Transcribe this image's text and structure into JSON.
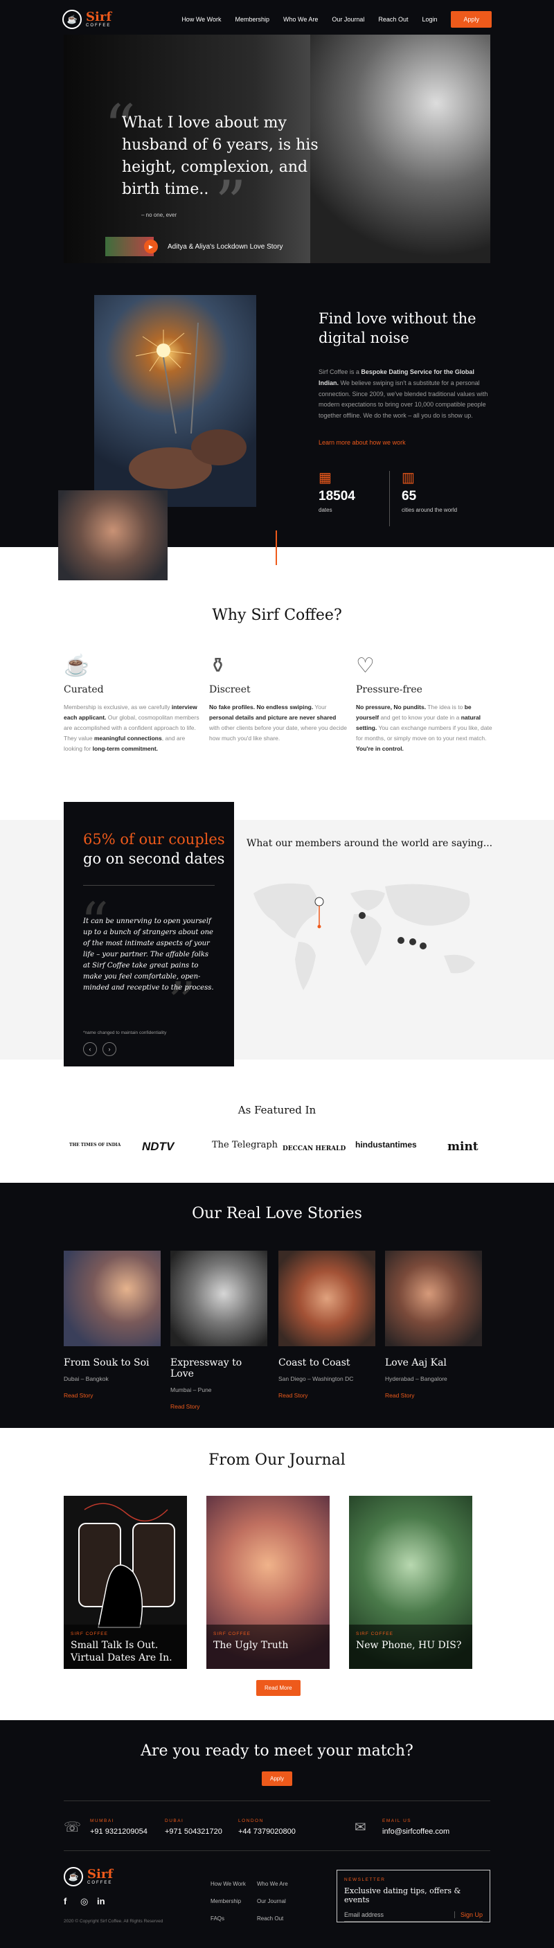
{
  "brand": {
    "logo_text": "Sirf",
    "logo_sub": "COFFEE"
  },
  "nav": {
    "items": [
      "How We Work",
      "Membership",
      "Who We Are",
      "Our Journal",
      "Reach Out",
      "Login"
    ],
    "apply": "Apply"
  },
  "hero": {
    "quote": "What I love about my husband of 6 years, is his height, complexion, and birth time..",
    "byline": "– no one, ever",
    "video_title": "Aditya & Aliya's Lockdown Love Story"
  },
  "intro": {
    "title": "Find love without the digital noise",
    "body_pre": "Sirf Coffee is a ",
    "body_bold": "Bespoke Dating Service for the Global Indian.",
    "body_post": " We believe swiping isn't a substitute for a personal connection. Since 2009, we've blended traditional values with modern expectations to bring over 10,000 compatible people together offline. We do the work – all you do is show up.",
    "link": "Learn more about how we work",
    "stats": [
      {
        "value": "18504",
        "label": "dates"
      },
      {
        "value": "65",
        "label": "cities around the world"
      }
    ]
  },
  "why": {
    "title": "Why Sirf Coffee?",
    "features": [
      {
        "title": "Curated",
        "text_1": "Membership is exclusive, as we carefully ",
        "bold_1": "interview each applicant.",
        "text_2": " Our global, cosmopolitan members are accomplished with a confident approach to life. They value ",
        "bold_2": "meaningful connections",
        "text_3": ", and are looking for ",
        "bold_3": "long-term commitment."
      },
      {
        "title": "Discreet",
        "text_1": "",
        "bold_1": "No fake profiles. No endless swiping.",
        "text_2": " Your ",
        "bold_2": "personal details and picture are never shared",
        "text_3": " with other clients before your date, where you decide how much you'd like share.",
        "bold_3": ""
      },
      {
        "title": "Pressure-free",
        "text_1": "",
        "bold_1": "No pressure, No pundits.",
        "text_2": " The idea is to ",
        "bold_2": "be yourself",
        "text_3": " and get to know your date in a ",
        "bold_3": "natural setting.",
        "text_4": " You can exchange numbers if you like, date for months, or simply move on to your next match. ",
        "bold_4": "You're in control."
      }
    ]
  },
  "testimonial": {
    "stat_highlight": "65% of our couples",
    "stat_rest": "go on second dates",
    "quote": "It can be unnerving to open yourself up to a bunch of strangers about one of the most intimate aspects of your life – your partner. The affable folks at Sirf Coffee take great pains to make you feel comfortable, open-minded and receptive to the process.",
    "note": "*name changed to maintain confidentiality",
    "prev": "‹",
    "next": "›",
    "members_title": "What our members around the world are saying..."
  },
  "featured": {
    "title": "As Featured In",
    "press": [
      "THE TIMES OF INDIA",
      "NDTV",
      "The Telegraph",
      "DECCAN HERALD",
      "hindustantimes",
      "mint"
    ]
  },
  "stories": {
    "title": "Our Real Love Stories",
    "read": "Read Story",
    "items": [
      {
        "title": "From Souk to Soi",
        "location": "Dubai – Bangkok"
      },
      {
        "title": "Expressway to Love",
        "location": "Mumbai – Pune"
      },
      {
        "title": "Coast to Coast",
        "location": "San Diego – Washington DC"
      },
      {
        "title": "Love Aaj Kal",
        "location": "Hyderabad – Bangalore"
      }
    ]
  },
  "journal": {
    "title": "From Our Journal",
    "brand": "SIRF COFFEE",
    "items": [
      "Small Talk Is Out. Virtual Dates Are In.",
      "The Ugly Truth",
      "New Phone, HU DIS?"
    ],
    "read_more": "Read More"
  },
  "footer": {
    "cta": "Are you ready to meet your match?",
    "apply": "Apply",
    "contacts": [
      {
        "city": "MUMBAI",
        "phone": "+91 9321209054"
      },
      {
        "city": "DUBAI",
        "phone": "+971 504321720"
      },
      {
        "city": "LONDON",
        "phone": "+44 7379020800"
      },
      {
        "city": "EMAIL US",
        "phone": "info@sirfcoffee.com"
      }
    ],
    "links_col1": [
      "How We Work",
      "Membership",
      "FAQs"
    ],
    "links_col2": [
      "Who We Are",
      "Our Journal",
      "Reach Out"
    ],
    "newsletter_label": "NEWSLETTER",
    "newsletter_title": "Exclusive dating tips, offers & events",
    "newsletter_placeholder": "Email address",
    "signup": "Sign Up",
    "copyright": "2020 © Copyright Sirf Coffee. All Rights Reserved"
  },
  "colors": {
    "accent": "#ee5a1b",
    "dark": "#0b0c10",
    "band": "#f4f4f4"
  }
}
